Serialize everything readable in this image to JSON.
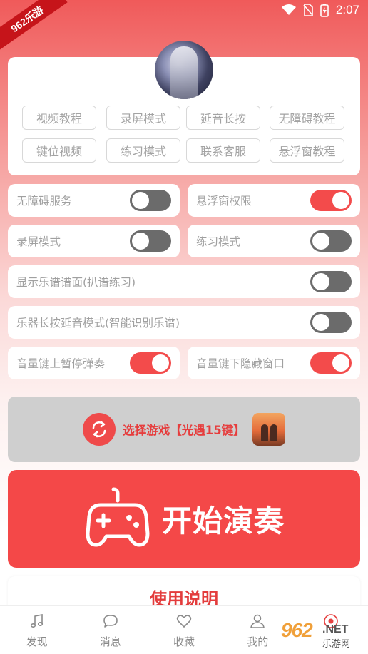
{
  "status_bar": {
    "ribbon_text": "962乐游",
    "time": "2:07",
    "icons": [
      "wifi-icon",
      "no-sim-icon",
      "battery-charging-icon"
    ]
  },
  "top_card": {
    "chips": [
      "视频教程",
      "录屏模式",
      "延音长按",
      "无障碍教程",
      "键位视频",
      "练习模式",
      "联系客服",
      "悬浮窗教程"
    ]
  },
  "settings": {
    "accessibility_service": {
      "label": "无障碍服务",
      "on": false
    },
    "floating_window_permission": {
      "label": "悬浮窗权限",
      "on": true
    },
    "screen_record_mode": {
      "label": "录屏模式",
      "on": false
    },
    "practice_mode": {
      "label": "练习模式",
      "on": false
    },
    "show_sheet": {
      "label": "显示乐谱谱面(扒谱练习)",
      "on": false
    },
    "long_press_sustain": {
      "label": "乐器长按延音模式(智能识别乐谱)",
      "on": false
    },
    "volume_up_pause": {
      "label": "音量键上暂停弹奏",
      "on": true
    },
    "volume_down_hide": {
      "label": "音量键下隐藏窗口",
      "on": true
    }
  },
  "select_game": {
    "text": "选择游戏【光遇15键】",
    "icon": "swap-arrows-icon"
  },
  "start_button": {
    "text": "开始演奏",
    "icon": "gamepad-icon"
  },
  "instructions": {
    "text": "使用说明"
  },
  "bottom_nav": {
    "items": [
      {
        "label": "发现",
        "icon": "music-note-icon"
      },
      {
        "label": "消息",
        "icon": "chat-bubble-icon"
      },
      {
        "label": "收藏",
        "icon": "heart-icon"
      },
      {
        "label": "我的",
        "icon": "user-icon"
      },
      {
        "label": "",
        "icon": "record-icon"
      }
    ]
  },
  "watermark": {
    "big": "962",
    "net": ".NET",
    "sub": "乐游网"
  },
  "colors": {
    "accent": "#f44848",
    "switch_off": "#6b6b6b",
    "select_bg": "#cfcfcf"
  }
}
